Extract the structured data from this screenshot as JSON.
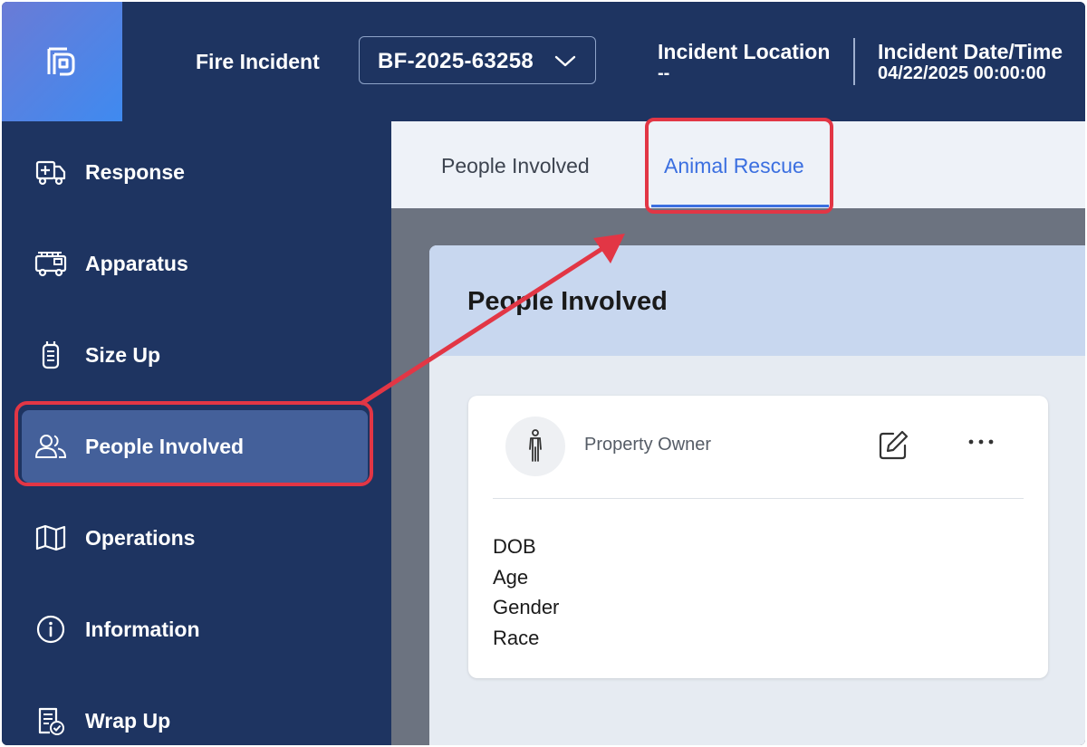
{
  "header": {
    "incident_type_label": "Fire Incident",
    "incident_number": "BF-2025-63258",
    "location_title": "Incident Location",
    "location_value": "--",
    "datetime_title": "Incident Date/Time",
    "datetime_value": "04/22/2025 00:00:00"
  },
  "sidebar": {
    "items": [
      {
        "label": "Response",
        "icon": "ambulance-icon"
      },
      {
        "label": "Apparatus",
        "icon": "fire-truck-icon"
      },
      {
        "label": "Size Up",
        "icon": "walkie-talkie-icon"
      },
      {
        "label": "People Involved",
        "icon": "people-icon",
        "active": true
      },
      {
        "label": "Operations",
        "icon": "map-icon"
      },
      {
        "label": "Information",
        "icon": "info-icon"
      },
      {
        "label": "Wrap Up",
        "icon": "checklist-icon"
      }
    ]
  },
  "tabs": [
    {
      "label": "People Involved",
      "selected": false
    },
    {
      "label": "Animal Rescue",
      "selected": true
    }
  ],
  "panel": {
    "title": "People Involved",
    "card": {
      "role": "Property Owner",
      "fields": [
        "DOB",
        "Age",
        "Gender",
        "Race"
      ]
    }
  },
  "colors": {
    "navy": "#1e3461",
    "active_nav": "#44609a",
    "accent_blue": "#3b6fe0",
    "annotation_red": "#e23645",
    "panel_header": "#c8d7ef"
  }
}
